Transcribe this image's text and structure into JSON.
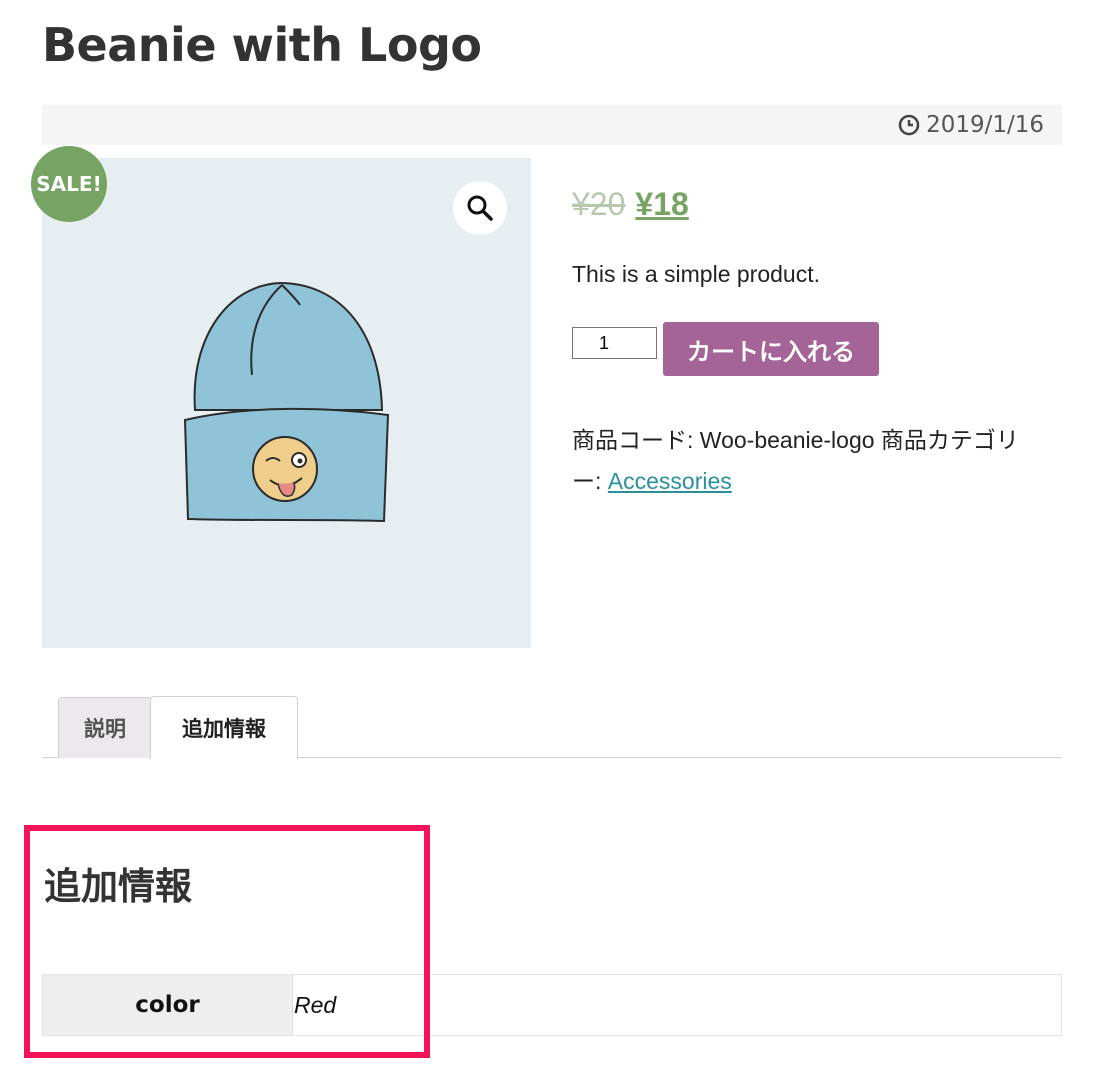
{
  "product": {
    "title": "Beanie with Logo",
    "date": "2019/1/16",
    "sale_badge": "SALE!",
    "old_price": "¥20",
    "new_price": "¥18",
    "short_description": "This is a simple product.",
    "quantity": "1",
    "add_to_cart_label": "カートに入れる",
    "sku_label": "商品コード: ",
    "sku_value": "Woo-beanie-logo",
    "category_label_line1": " 商品カテゴリ",
    "category_label_line2": "ー: ",
    "category_link": "Accessories"
  },
  "tabs": [
    {
      "label": "説明",
      "active": false
    },
    {
      "label": "追加情報",
      "active": true
    }
  ],
  "additional_info": {
    "heading": "追加情報",
    "rows": [
      {
        "attribute": "color",
        "value": "Red"
      }
    ]
  },
  "icons": {
    "date": "clock-icon",
    "zoom": "magnifier-icon"
  },
  "colors": {
    "sale_badge": "#77a464",
    "price": "#77a464",
    "cart_button": "#a46497",
    "link": "#2a8fa0",
    "highlight": "#f21459"
  }
}
